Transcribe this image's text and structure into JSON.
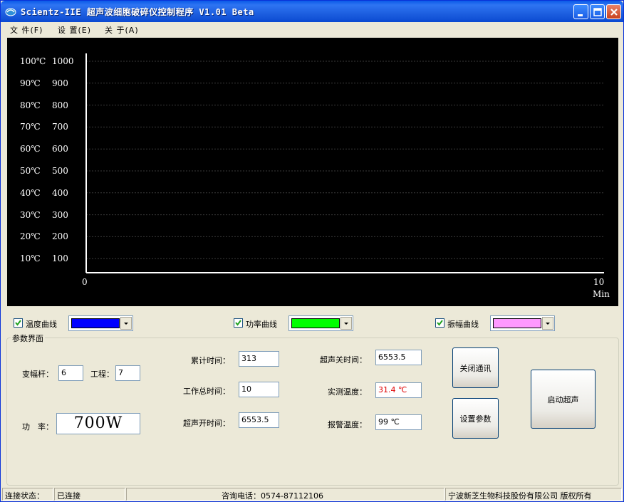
{
  "window": {
    "title": "Scientz-IIE 超声波细胞破碎仪控制程序 V1.01 Beta"
  },
  "menu": [
    {
      "label": "文 件(F)"
    },
    {
      "label": "设 置(E)"
    },
    {
      "label": "关 于(A)"
    }
  ],
  "chart_data": {
    "type": "line",
    "y_labels_temperature": [
      "100℃",
      "90℃",
      "80℃",
      "70℃",
      "60℃",
      "50℃",
      "40℃",
      "30℃",
      "20℃",
      "10℃"
    ],
    "y_labels_power": [
      "1000",
      "900",
      "800",
      "700",
      "600",
      "500",
      "400",
      "300",
      "200",
      "100"
    ],
    "x_labels": [
      "0",
      "10"
    ],
    "xlabel": "Min",
    "xlim": [
      0,
      10
    ],
    "ylim_temperature": [
      0,
      100
    ],
    "ylim_power": [
      0,
      1000
    ],
    "series": [],
    "grid": true,
    "background": "#000000",
    "axis_color": "#ffffff"
  },
  "legend": {
    "temperature": {
      "label": "温度曲线",
      "checked": true,
      "color": "#0000ff"
    },
    "power": {
      "label": "功率曲线",
      "checked": true,
      "color": "#00ff00"
    },
    "amplitude": {
      "label": "振幅曲线",
      "checked": true,
      "color": "#ff99ff"
    }
  },
  "params": {
    "group_title": "参数界面",
    "horn_label": "变幅杆：",
    "horn_value": "6",
    "process_label": "工程：",
    "process_value": "7",
    "power_label": "功　率：",
    "power_value": "700W",
    "cumulative_time_label": "累计时间：",
    "cumulative_time_value": "313",
    "total_work_time_label": "工作总时间：",
    "total_work_time_value": "10",
    "sonic_on_time_label": "超声开时间：",
    "sonic_on_time_value": "6553.5",
    "sonic_off_time_label": "超声关时间：",
    "sonic_off_time_value": "6553.5",
    "measured_temp_label": "实测温度：",
    "measured_temp_value": "31.4 ℃",
    "measured_temp_color": "#e00000",
    "alarm_temp_label": "报警温度：",
    "alarm_temp_value": "99 ℃"
  },
  "buttons": {
    "close_comm": "关闭通讯",
    "set_params": "设置参数",
    "start_sonic": "启动超声"
  },
  "status": {
    "conn_label": "连接状态：",
    "conn_value": "已连接",
    "phone": "咨询电话：0574-87112106",
    "copyright": "宁波新芝生物科技股份有限公司 版权所有"
  }
}
